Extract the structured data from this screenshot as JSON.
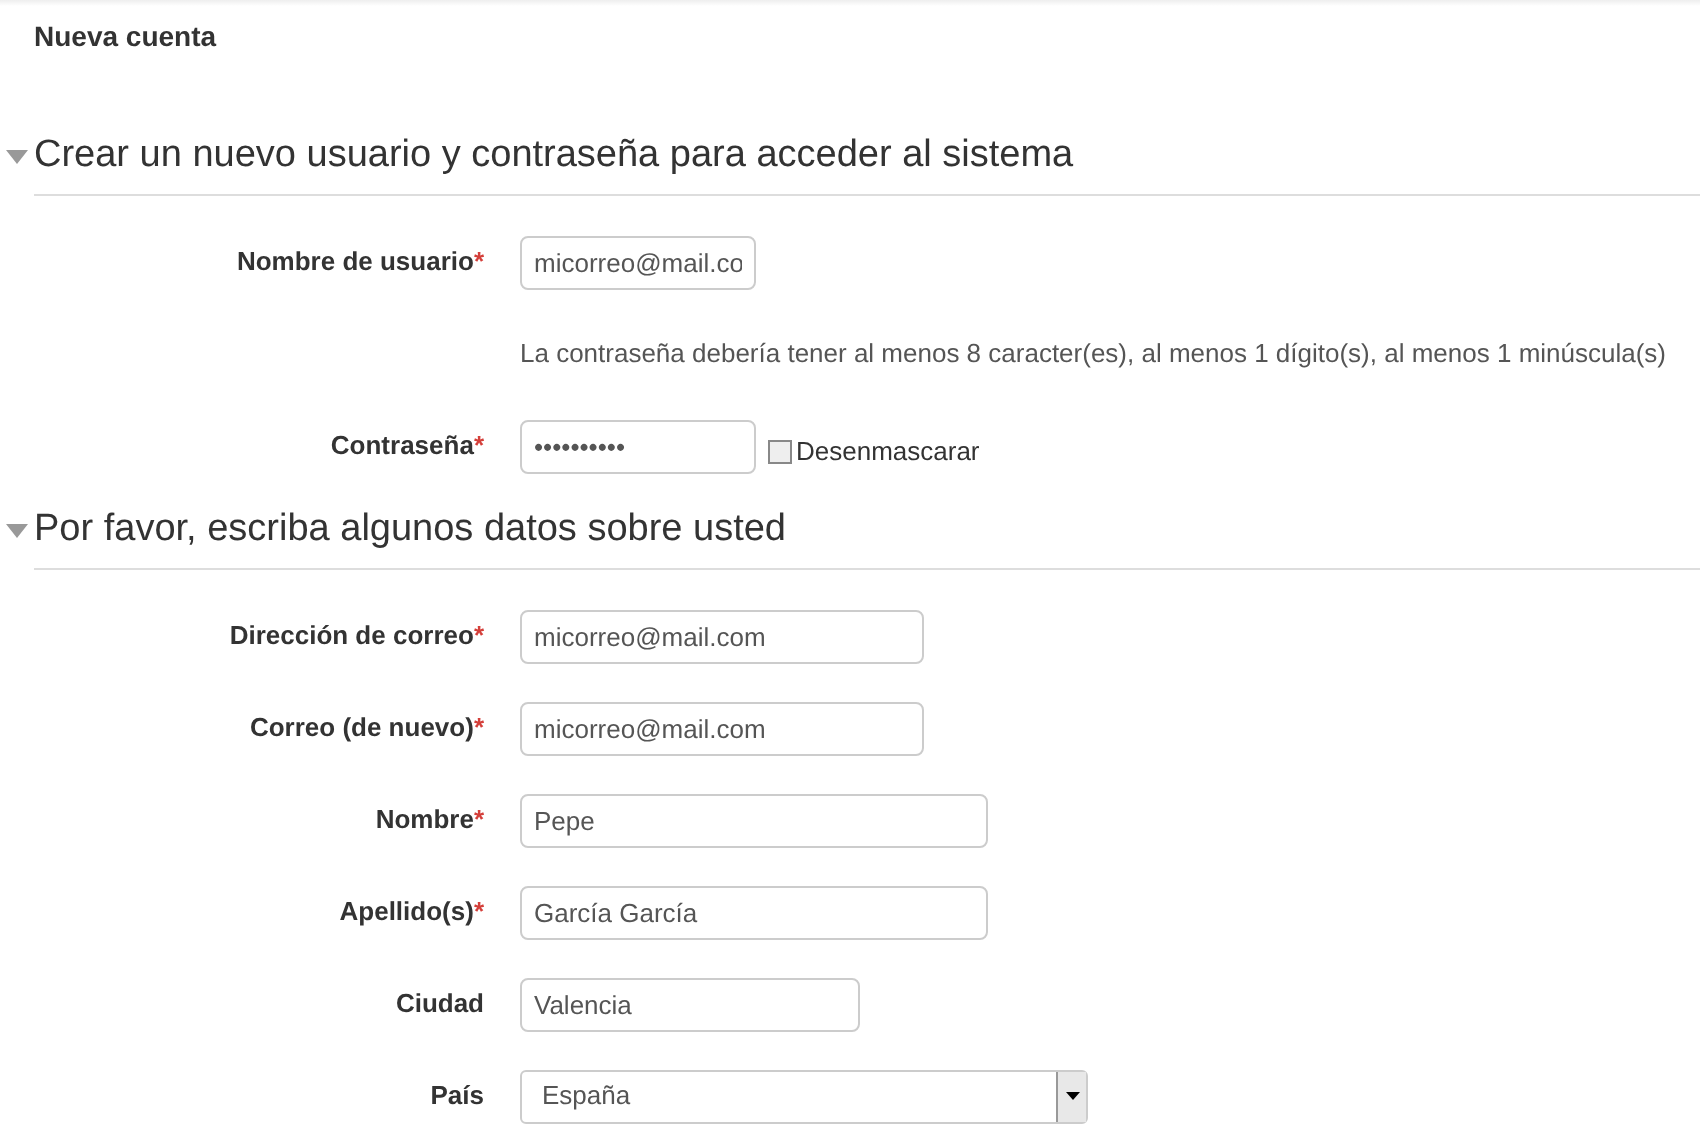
{
  "page_title": "Nueva cuenta",
  "sections": [
    {
      "title": "Crear un nuevo usuario y contraseña para acceder al sistema",
      "expanded": true,
      "rows": [
        {
          "kind": "text",
          "label": "Nombre de usuario",
          "required_mark": "*",
          "value": "micorreo@mail.co"
        },
        {
          "kind": "hint",
          "text": "La contraseña debería tener al menos 8 caracter(es), al menos 1 dígito(s), al menos 1 minúscula(s)"
        },
        {
          "kind": "password",
          "label": "Contraseña",
          "required_mark": "*",
          "value": "••••••••••",
          "checkbox": {
            "label": "Desenmascarar",
            "checked": false
          }
        }
      ]
    },
    {
      "title": "Por favor, escriba algunos datos sobre usted",
      "expanded": true,
      "rows": [
        {
          "kind": "text",
          "label": "Dirección de correo",
          "required_mark": "*",
          "value": "micorreo@mail.com"
        },
        {
          "kind": "text",
          "label": "Correo (de nuevo)",
          "required_mark": "*",
          "value": "micorreo@mail.com"
        },
        {
          "kind": "text",
          "label": "Nombre",
          "required_mark": "*",
          "value": "Pepe"
        },
        {
          "kind": "text",
          "label": "Apellido(s)",
          "required_mark": "*",
          "value": "García García"
        },
        {
          "kind": "text",
          "label": "Ciudad",
          "value": "Valencia"
        },
        {
          "kind": "select",
          "label": "País",
          "value": "España"
        }
      ]
    }
  ]
}
